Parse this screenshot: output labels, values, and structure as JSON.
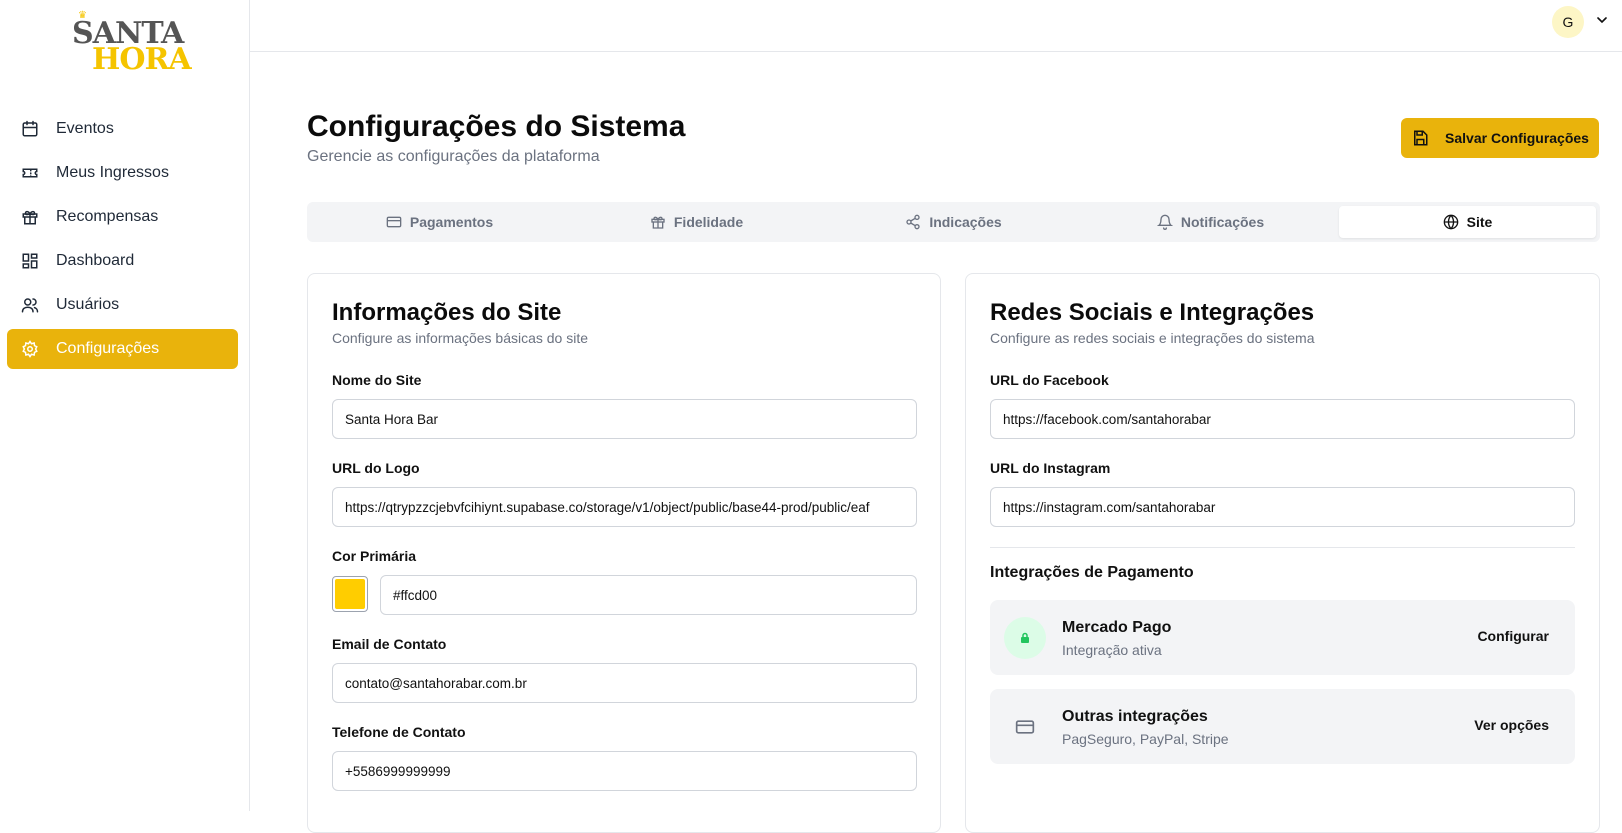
{
  "brand": {
    "line1": "SANTA",
    "line2": "HORA"
  },
  "sidebar": {
    "items": [
      {
        "label": "Eventos",
        "icon": "calendar-icon",
        "active": false
      },
      {
        "label": "Meus Ingressos",
        "icon": "ticket-icon",
        "active": false
      },
      {
        "label": "Recompensas",
        "icon": "gift-icon",
        "active": false
      },
      {
        "label": "Dashboard",
        "icon": "dashboard-icon",
        "active": false
      },
      {
        "label": "Usuários",
        "icon": "users-icon",
        "active": false
      },
      {
        "label": "Configurações",
        "icon": "gear-icon",
        "active": true
      }
    ]
  },
  "topbar": {
    "avatar_initial": "G"
  },
  "header": {
    "title": "Configurações do Sistema",
    "subtitle": "Gerencie as configurações da plataforma",
    "save_label": "Salvar Configurações"
  },
  "tabs": [
    {
      "label": "Pagamentos",
      "icon": "credit-card-icon",
      "active": false
    },
    {
      "label": "Fidelidade",
      "icon": "gift-icon",
      "active": false
    },
    {
      "label": "Indicações",
      "icon": "share-icon",
      "active": false
    },
    {
      "label": "Notificações",
      "icon": "bell-icon",
      "active": false
    },
    {
      "label": "Site",
      "icon": "globe-icon",
      "active": true
    }
  ],
  "site_info": {
    "title": "Informações do Site",
    "subtitle": "Configure as informações básicas do site",
    "site_name_label": "Nome do Site",
    "site_name_value": "Santa Hora Bar",
    "logo_url_label": "URL do Logo",
    "logo_url_value": "https://qtrypzzcjebvfcihiynt.supabase.co/storage/v1/object/public/base44-prod/public/eaf",
    "primary_color_label": "Cor Primária",
    "primary_color_value": "#ffcd00",
    "contact_email_label": "Email de Contato",
    "contact_email_value": "contato@santahorabar.com.br",
    "contact_phone_label": "Telefone de Contato",
    "contact_phone_value": "+5586999999999"
  },
  "social": {
    "title": "Redes Sociais e Integrações",
    "subtitle": "Configure as redes sociais e integrações do sistema",
    "facebook_label": "URL do Facebook",
    "facebook_value": "https://facebook.com/santahorabar",
    "instagram_label": "URL do Instagram",
    "instagram_value": "https://instagram.com/santahorabar",
    "payment_section_title": "Integrações de Pagamento",
    "integrations": [
      {
        "name": "Mercado Pago",
        "description": "Integração ativa",
        "action": "Configurar",
        "icon": "lock-icon"
      },
      {
        "name": "Outras integrações",
        "description": "PagSeguro, PayPal, Stripe",
        "action": "Ver opções",
        "icon": "credit-card-icon"
      }
    ]
  },
  "colors": {
    "accent": "#e9b30c",
    "primary_swatch": "#ffcd00",
    "active_integration_bg": "#dcfce7",
    "active_integration_icon": "#22c55e"
  }
}
